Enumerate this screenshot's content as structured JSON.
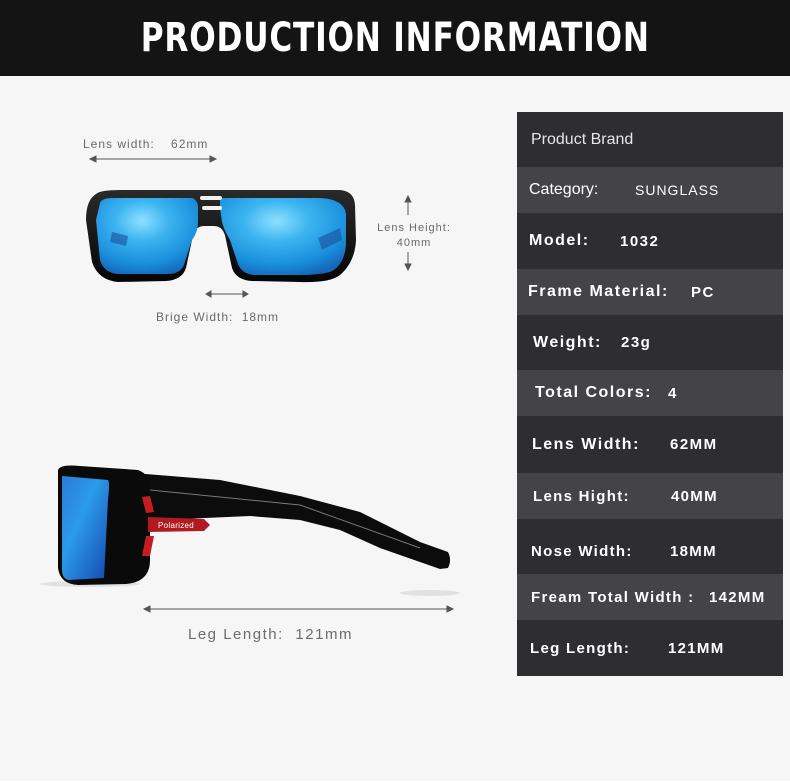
{
  "header": {
    "title": "PRODUCTION INFORMATION"
  },
  "front_view": {
    "lens_width_label": "Lens width:",
    "lens_width_value": "62mm",
    "lens_height_label": "Lens Height:",
    "lens_height_value": "40mm",
    "bridge_width_label": "Brige Width:",
    "bridge_width_value": "18mm"
  },
  "side_view": {
    "temple_badge": "Polarized",
    "leg_length_label": "Leg Length:",
    "leg_length_value": "121mm"
  },
  "colors": {
    "header_bg": "#141414",
    "page_bg": "#f6f6f6",
    "row_dark": "#2e2e30",
    "row_light": "#444446",
    "lens_blue": "#2aa6ea",
    "accent_red": "#c41e24"
  },
  "specs": [
    {
      "label": "Product Brand",
      "value": ""
    },
    {
      "label": "Category:",
      "value": "SUNGLASS"
    },
    {
      "label": "Model:",
      "value": "1032"
    },
    {
      "label": "Frame Material:",
      "value": "PC"
    },
    {
      "label": "Weight:",
      "value": "23g"
    },
    {
      "label": "Total Colors:",
      "value": "4"
    },
    {
      "label": "Lens Width:",
      "value": "62MM"
    },
    {
      "label": "Lens Hight:",
      "value": "40MM"
    },
    {
      "label": "Nose Width:",
      "value": "18MM"
    },
    {
      "label": "Fream Total Width :",
      "value": "142MM"
    },
    {
      "label": "Leg Length:",
      "value": "121MM"
    }
  ]
}
